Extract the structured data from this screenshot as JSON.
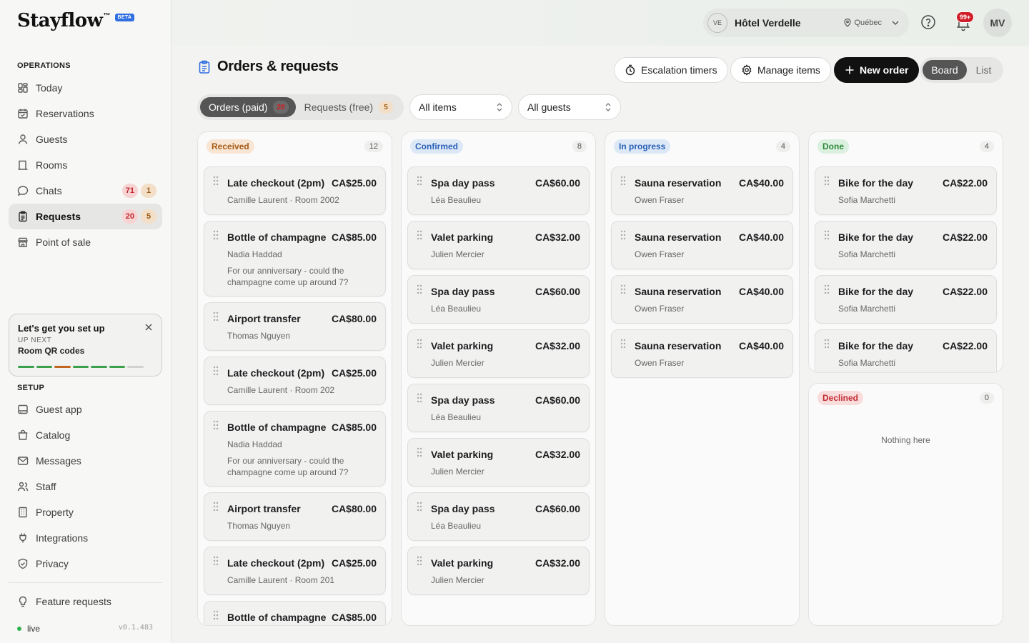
{
  "brand": {
    "name": "Stayflow",
    "tm": "™",
    "badge": "BETA"
  },
  "sidebar": {
    "operations_label": "OPERATIONS",
    "operations": [
      {
        "label": "Today",
        "icon": "grid-icon"
      },
      {
        "label": "Reservations",
        "icon": "calendar-check-icon"
      },
      {
        "label": "Guests",
        "icon": "user-icon"
      },
      {
        "label": "Rooms",
        "icon": "bed-icon"
      },
      {
        "label": "Chats",
        "icon": "chat-icon",
        "badges": [
          "71",
          "1"
        ]
      },
      {
        "label": "Requests",
        "icon": "clipboard-icon",
        "badges": [
          "20",
          "5"
        ],
        "active": true
      },
      {
        "label": "Point of sale",
        "icon": "store-icon"
      }
    ],
    "setup_card": {
      "title": "Let's get you set up",
      "next_label": "UP NEXT",
      "next_item": "Room QR codes",
      "progress_steps": [
        "done",
        "done",
        "current",
        "done",
        "done",
        "done",
        "todo"
      ]
    },
    "setup_label": "SETUP",
    "setup": [
      {
        "label": "Guest app",
        "icon": "phone-icon"
      },
      {
        "label": "Catalog",
        "icon": "bag-icon"
      },
      {
        "label": "Messages",
        "icon": "mail-icon"
      },
      {
        "label": "Staff",
        "icon": "users-icon"
      },
      {
        "label": "Property",
        "icon": "building-icon"
      },
      {
        "label": "Integrations",
        "icon": "plug-icon"
      },
      {
        "label": "Privacy",
        "icon": "shield-icon"
      }
    ],
    "feature_requests": "Feature requests",
    "status": "live",
    "version": "v0.1.483"
  },
  "topbar": {
    "hotel_initials": "VE",
    "hotel_name": "Hôtel Verdelle",
    "hotel_location": "Québec",
    "notifications_badge": "99+",
    "user_initials": "MV"
  },
  "header": {
    "title": "Orders & requests",
    "escalation_label": "Escalation timers",
    "manage_label": "Manage items",
    "new_order_label": "New order",
    "view_board": "Board",
    "view_list": "List"
  },
  "filters": {
    "tab_orders": "Orders (paid)",
    "tab_orders_badge": "28",
    "tab_requests": "Requests (free)",
    "tab_requests_badge": "5",
    "items_select": "All items",
    "guests_select": "All guests"
  },
  "board": {
    "received": {
      "label": "Received",
      "count": "12",
      "cards": [
        {
          "title": "Late checkout (2pm)",
          "price": "CA$25.00",
          "sub": "Camille Laurent · Room 2002"
        },
        {
          "title": "Bottle of champagne",
          "price": "CA$85.00",
          "sub": "Nadia Haddad",
          "note": "For our anniversary - could the champagne come up around 7?"
        },
        {
          "title": "Airport transfer",
          "price": "CA$80.00",
          "sub": "Thomas Nguyen"
        },
        {
          "title": "Late checkout (2pm)",
          "price": "CA$25.00",
          "sub": "Camille Laurent · Room 202"
        },
        {
          "title": "Bottle of champagne",
          "price": "CA$85.00",
          "sub": "Nadia Haddad",
          "note": "For our anniversary - could the champagne come up around 7?"
        },
        {
          "title": "Airport transfer",
          "price": "CA$80.00",
          "sub": "Thomas Nguyen"
        },
        {
          "title": "Late checkout (2pm)",
          "price": "CA$25.00",
          "sub": "Camille Laurent · Room 201"
        },
        {
          "title": "Bottle of champagne",
          "price": "CA$85.00",
          "sub": ""
        }
      ]
    },
    "confirmed": {
      "label": "Confirmed",
      "count": "8",
      "cards": [
        {
          "title": "Spa day pass",
          "price": "CA$60.00",
          "sub": "Léa Beaulieu"
        },
        {
          "title": "Valet parking",
          "price": "CA$32.00",
          "sub": "Julien Mercier"
        },
        {
          "title": "Spa day pass",
          "price": "CA$60.00",
          "sub": "Léa Beaulieu"
        },
        {
          "title": "Valet parking",
          "price": "CA$32.00",
          "sub": "Julien Mercier"
        },
        {
          "title": "Spa day pass",
          "price": "CA$60.00",
          "sub": "Léa Beaulieu"
        },
        {
          "title": "Valet parking",
          "price": "CA$32.00",
          "sub": "Julien Mercier"
        },
        {
          "title": "Spa day pass",
          "price": "CA$60.00",
          "sub": "Léa Beaulieu"
        },
        {
          "title": "Valet parking",
          "price": "CA$32.00",
          "sub": "Julien Mercier"
        }
      ]
    },
    "in_progress": {
      "label": "In progress",
      "count": "4",
      "cards": [
        {
          "title": "Sauna reservation",
          "price": "CA$40.00",
          "sub": "Owen Fraser"
        },
        {
          "title": "Sauna reservation",
          "price": "CA$40.00",
          "sub": "Owen Fraser"
        },
        {
          "title": "Sauna reservation",
          "price": "CA$40.00",
          "sub": "Owen Fraser"
        },
        {
          "title": "Sauna reservation",
          "price": "CA$40.00",
          "sub": "Owen Fraser"
        }
      ]
    },
    "done": {
      "label": "Done",
      "count": "4",
      "cards": [
        {
          "title": "Bike for the day",
          "price": "CA$22.00",
          "sub": "Sofia Marchetti"
        },
        {
          "title": "Bike for the day",
          "price": "CA$22.00",
          "sub": "Sofia Marchetti"
        },
        {
          "title": "Bike for the day",
          "price": "CA$22.00",
          "sub": "Sofia Marchetti"
        },
        {
          "title": "Bike for the day",
          "price": "CA$22.00",
          "sub": "Sofia Marchetti"
        }
      ]
    },
    "declined": {
      "label": "Declined",
      "count": "0",
      "empty_text": "Nothing here"
    }
  }
}
